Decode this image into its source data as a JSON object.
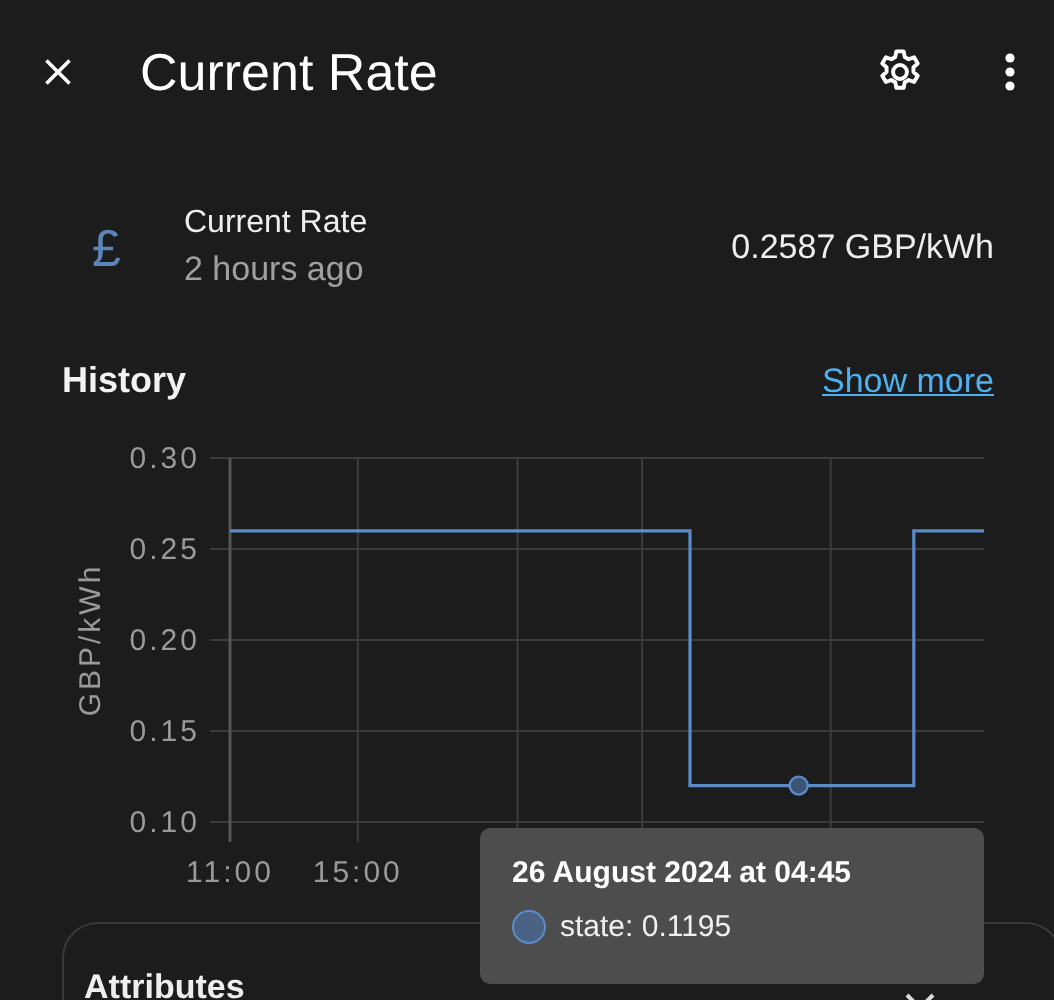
{
  "header": {
    "title": "Current Rate"
  },
  "entity": {
    "icon": "£",
    "name": "Current Rate",
    "updated": "2 hours ago",
    "state": "0.2587 GBP/kWh"
  },
  "history": {
    "title": "History",
    "link": "Show more",
    "chart_data": {
      "type": "line",
      "grid": true,
      "ylabel": "GBP/kWh",
      "ylim": [
        0.1,
        0.3
      ],
      "yticks": [
        {
          "value": 0.1,
          "label": "0.10"
        },
        {
          "value": 0.15,
          "label": "0.15"
        },
        {
          "value": 0.2,
          "label": "0.20"
        },
        {
          "value": 0.25,
          "label": "0.25"
        },
        {
          "value": 0.3,
          "label": "0.30"
        }
      ],
      "xlim": [
        11,
        34.6
      ],
      "xticks": [
        {
          "value": 11,
          "label": "11:00"
        },
        {
          "value": 15,
          "label": "15:00"
        }
      ],
      "x": [
        11,
        25.4,
        25.4,
        32.4,
        32.4,
        34.6
      ],
      "series": [
        {
          "color": "#5b8cc8",
          "values": [
            0.26,
            0.26,
            0.12,
            0.12,
            0.26,
            0.26
          ]
        }
      ]
    },
    "tooltip": {
      "title": "26 August 2024 at 04:45",
      "label": "state: 0.1195"
    }
  },
  "attributes": {
    "title": "Attributes",
    "expanded": false
  }
}
